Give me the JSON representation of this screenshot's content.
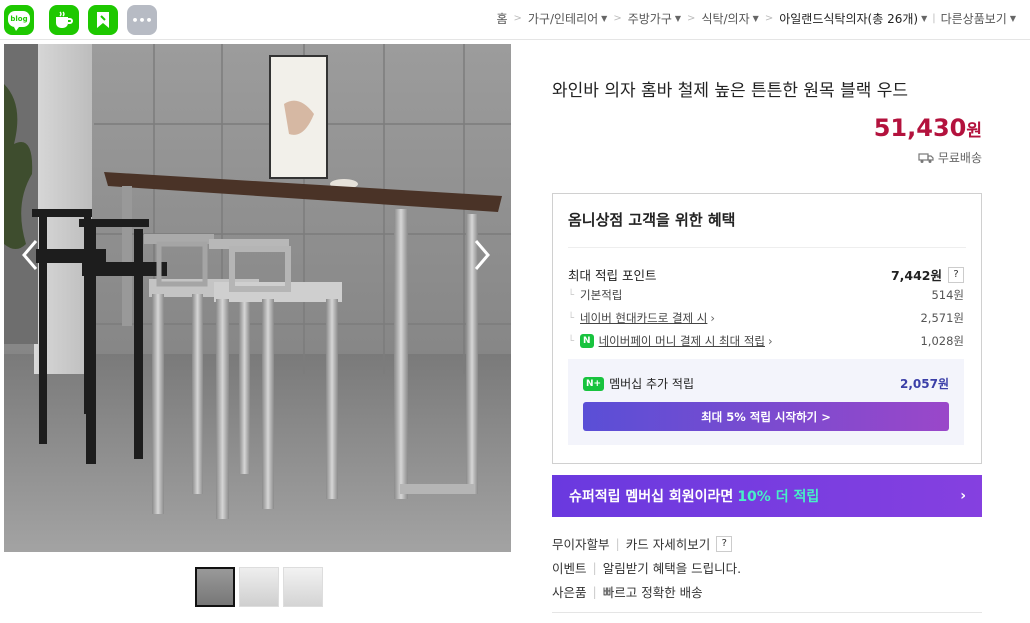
{
  "top_icons": [
    {
      "name": "blog-icon",
      "label": "blog",
      "color": "#1ec800"
    },
    {
      "name": "cafe-icon",
      "label": "",
      "color": "#1ec800"
    },
    {
      "name": "bookmark-icon",
      "label": "",
      "color": "#1ec800"
    },
    {
      "name": "more-icon",
      "label": "•••",
      "color": "#b7bbc4"
    }
  ],
  "breadcrumb": {
    "home": "홈",
    "items": [
      "가구/인테리어",
      "주방가구",
      "식탁/의자"
    ],
    "current": "아일랜드식탁의자",
    "count": "(총 26개)",
    "other": "다른상품보기"
  },
  "product": {
    "title": "와인바 의자 홈바 철제 높은 튼튼한 원목 블랙 우드",
    "price": "51,430",
    "price_unit": "원",
    "shipping": "무료배송"
  },
  "benefit": {
    "title": "옴니상점 고객을 위한 혜택",
    "max_points_label": "최대 적립 포인트",
    "max_points_value": "7,442원",
    "question": "?",
    "rows": [
      {
        "label": "기본적립",
        "value": "514원",
        "link": false,
        "badge": false
      },
      {
        "label": "네이버 현대카드로 결제 시",
        "value": "2,571원",
        "link": true,
        "badge": false
      },
      {
        "label": "네이버페이 머니 결제 시 최대 적립",
        "value": "1,028원",
        "link": true,
        "badge": true
      }
    ],
    "membership": {
      "badge": "N+",
      "label": "멤버십 추가 적립",
      "value": "2,057원",
      "button": "최대 5% 적립 시작하기 >"
    }
  },
  "banner": {
    "text1": "슈퍼적립 멤버십 회원이라면",
    "text2": "10% 더 적립",
    "chevron": "›",
    "colors": {
      "bg": "#6a39df",
      "highlight": "#47f0c7"
    }
  },
  "info_rows": [
    {
      "key": "무이자할부",
      "value": "카드 자세히보기",
      "help": "?"
    },
    {
      "key": "이벤트",
      "value": "알림받기 혜택을 드립니다.",
      "help": ""
    },
    {
      "key": "사은품",
      "value": "빠르고 정확한 배송",
      "help": ""
    }
  ],
  "accent_price": "#b3123d"
}
